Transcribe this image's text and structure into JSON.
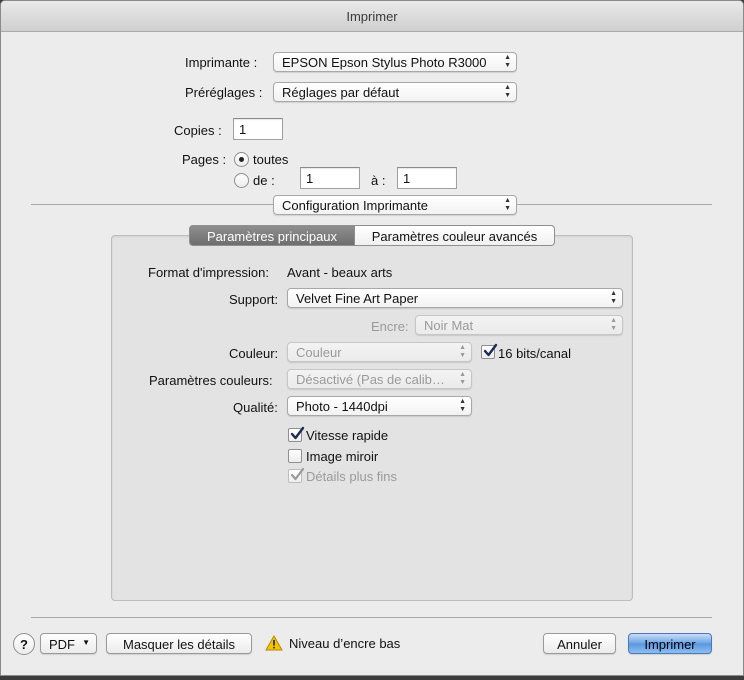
{
  "window": {
    "title": "Imprimer"
  },
  "printer": {
    "label": "Imprimante :",
    "value": "EPSON Epson Stylus Photo R3000"
  },
  "presets": {
    "label": "Préréglages :",
    "value": "Réglages par défaut"
  },
  "copies": {
    "label": "Copies :",
    "value": "1"
  },
  "pages": {
    "label": "Pages :",
    "all_label": "toutes",
    "range_label": "de :",
    "from_value": "1",
    "to_label": "à :",
    "to_value": "1"
  },
  "section_popup": {
    "value": "Configuration Imprimante"
  },
  "tabs": [
    {
      "label": "Paramètres principaux",
      "selected": true
    },
    {
      "label": "Paramètres couleur avancés",
      "selected": false
    }
  ],
  "settings": {
    "format_label": "Format d'impression:",
    "format_value": "Avant - beaux arts",
    "support_label": "Support:",
    "support_value": "Velvet Fine Art Paper",
    "ink_label": "Encre:",
    "ink_value": "Noir Mat",
    "color_label": "Couleur:",
    "color_value": "Couleur",
    "bits_label": "16 bits/canal",
    "color_params_label": "Paramètres couleurs:",
    "color_params_value": "Désactivé (Pas de calib…",
    "quality_label": "Qualité:",
    "quality_value": "Photo - 1440dpi",
    "fast_label": "Vitesse rapide",
    "mirror_label": "Image miroir",
    "fine_label": "Détails plus fins"
  },
  "footer": {
    "help": "?",
    "pdf_label": "PDF",
    "hide_details_label": "Masquer les détails",
    "warning_text": "Niveau d’encre bas",
    "cancel_label": "Annuler",
    "print_label": "Imprimer"
  },
  "colors": {
    "accent": "#5a96df",
    "warning": "#f5c400"
  }
}
